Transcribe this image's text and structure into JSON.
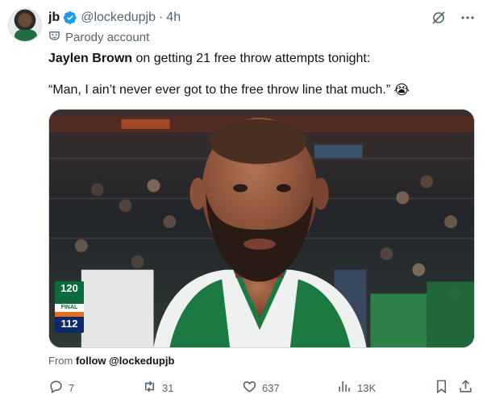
{
  "author": {
    "name": "jb",
    "handle": "@lockedupjb",
    "separator": "·",
    "time": "4h",
    "parody_label": "Parody account"
  },
  "tweet": {
    "line1_bold": "Jaylen Brown",
    "line1_rest": " on getting 21 free throw attempts tonight:",
    "quote": "“Man, I ain’t never ever got to the free throw line that much.”",
    "emoji": "😭"
  },
  "media": {
    "score_top": "120",
    "score_status": "FINAL",
    "score_bottom": "112"
  },
  "source": {
    "prefix": "From ",
    "link": "follow @lockedupjb"
  },
  "actions": {
    "replies": "7",
    "reposts": "31",
    "likes": "637",
    "views": "13K"
  },
  "icons": [
    "verified-badge-icon",
    "parody-mask-icon",
    "grok-icon",
    "more-icon",
    "reply-icon",
    "repost-icon",
    "like-icon",
    "views-icon",
    "bookmark-icon",
    "share-icon"
  ],
  "colors": {
    "verified": "#1d9bf0",
    "text_secondary": "#536471",
    "celtics_green": "#0b6b3a"
  }
}
